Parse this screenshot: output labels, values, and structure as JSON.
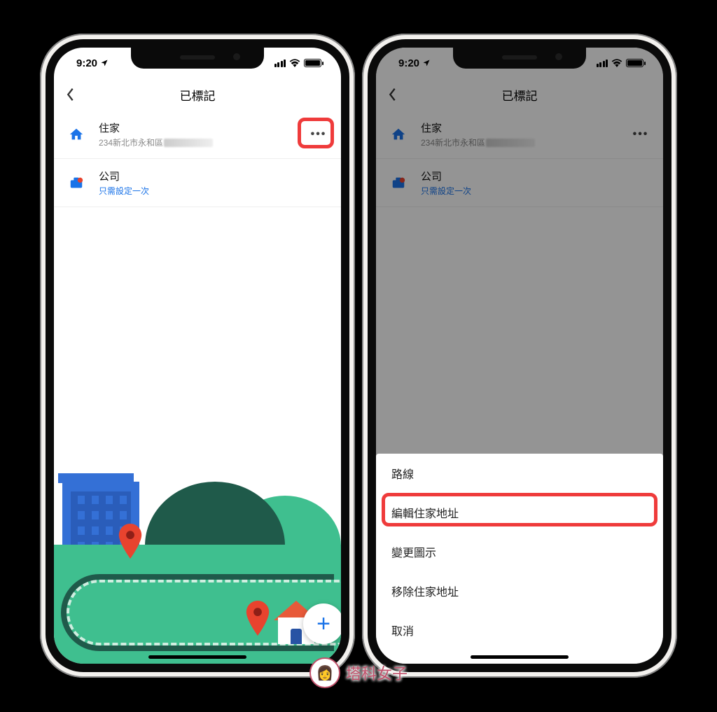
{
  "status": {
    "time": "9:20",
    "location_arrow": "➤"
  },
  "nav": {
    "title": "已標記"
  },
  "list": {
    "home": {
      "title": "住家",
      "sub": "234新北市永和區"
    },
    "work": {
      "title": "公司",
      "sub": "只需設定一次"
    }
  },
  "fab": {
    "label": "+"
  },
  "sheet": {
    "items": [
      "路線",
      "編輯住家地址",
      "變更圖示",
      "移除住家地址",
      "取消"
    ]
  },
  "watermark": "塔科女子"
}
